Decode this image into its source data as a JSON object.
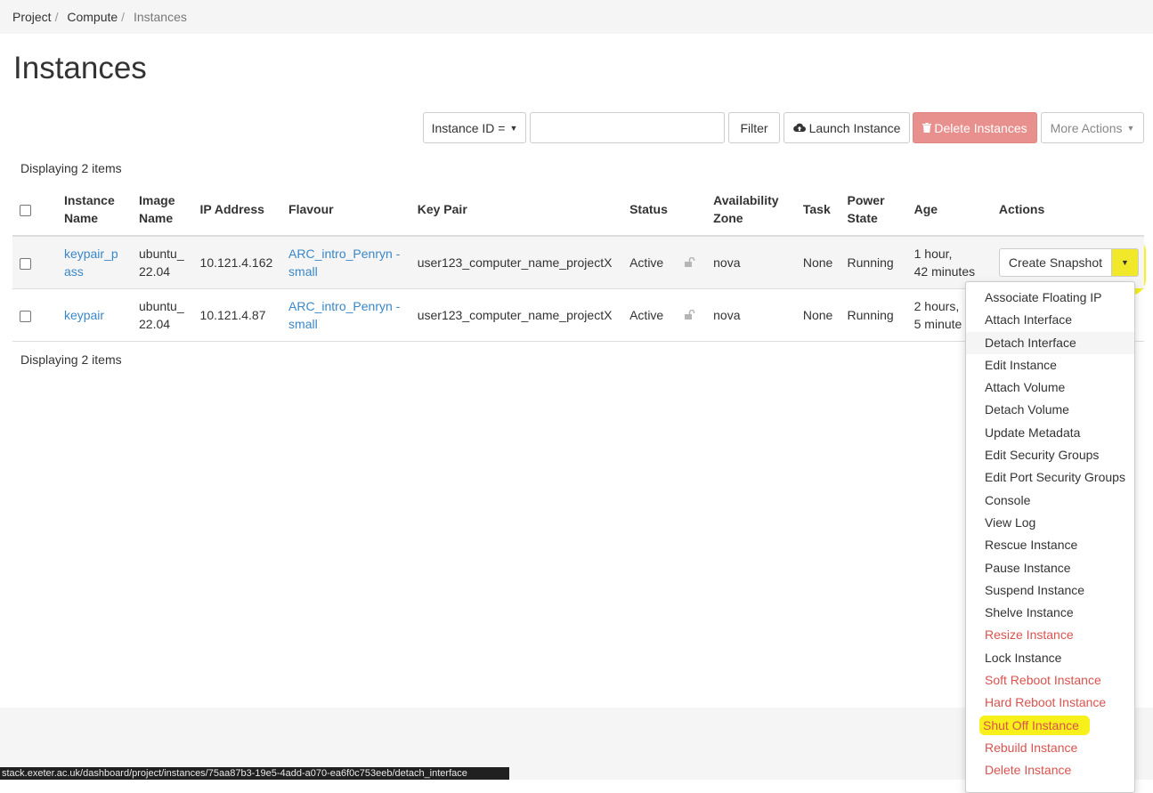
{
  "breadcrumb": [
    "Project",
    "Compute",
    "Instances"
  ],
  "page_title": "Instances",
  "toolbar": {
    "filter_field": "Instance ID =",
    "filter_value": "",
    "filter_label": "Filter",
    "launch_label": "Launch Instance",
    "delete_label": "Delete Instances",
    "more_label": "More Actions"
  },
  "count_text": "Displaying 2 items",
  "table": {
    "headers": {
      "name": [
        "Instance",
        "Name"
      ],
      "image": [
        "Image",
        "Name"
      ],
      "ip": "IP Address",
      "flavour": "Flavour",
      "keypair": "Key Pair",
      "status": "Status",
      "zone": [
        "Availability",
        "Zone"
      ],
      "task": "Task",
      "power": [
        "Power",
        "State"
      ],
      "age": "Age",
      "actions": "Actions"
    },
    "rows": [
      {
        "name": [
          "keypair_p",
          "ass"
        ],
        "image": [
          "ubuntu_",
          "22.04"
        ],
        "ip": "10.121.4.162",
        "flavour": [
          "ARC_intro_Penryn -",
          "small"
        ],
        "keypair": "user123_computer_name_projectX",
        "status": "Active",
        "zone": "nova",
        "task": "None",
        "power": "Running",
        "age": [
          "1 hour,",
          "42 minutes"
        ],
        "action": "Create Snapshot"
      },
      {
        "name": [
          "keypair",
          ""
        ],
        "image": [
          "ubuntu_",
          "22.04"
        ],
        "ip": "10.121.4.87",
        "flavour": [
          "ARC_intro_Penryn -",
          "small"
        ],
        "keypair": "user123_computer_name_projectX",
        "status": "Active",
        "zone": "nova",
        "task": "None",
        "power": "Running",
        "age": [
          "2 hours,",
          "5 minute"
        ],
        "action": ""
      }
    ]
  },
  "dropdown": [
    {
      "label": "Associate Floating IP",
      "danger": false
    },
    {
      "label": "Attach Interface",
      "danger": false
    },
    {
      "label": "Detach Interface",
      "danger": false,
      "hover": true
    },
    {
      "label": "Edit Instance",
      "danger": false
    },
    {
      "label": "Attach Volume",
      "danger": false
    },
    {
      "label": "Detach Volume",
      "danger": false
    },
    {
      "label": "Update Metadata",
      "danger": false
    },
    {
      "label": "Edit Security Groups",
      "danger": false
    },
    {
      "label": "Edit Port Security Groups",
      "danger": false
    },
    {
      "label": "Console",
      "danger": false
    },
    {
      "label": "View Log",
      "danger": false
    },
    {
      "label": "Rescue Instance",
      "danger": false
    },
    {
      "label": "Pause Instance",
      "danger": false
    },
    {
      "label": "Suspend Instance",
      "danger": false
    },
    {
      "label": "Shelve Instance",
      "danger": false
    },
    {
      "label": "Resize Instance",
      "danger": true
    },
    {
      "label": "Lock Instance",
      "danger": false
    },
    {
      "label": "Soft Reboot Instance",
      "danger": true
    },
    {
      "label": "Hard Reboot Instance",
      "danger": true
    },
    {
      "label": "Shut Off Instance",
      "danger": true,
      "highlight": true
    },
    {
      "label": "Rebuild Instance",
      "danger": true
    },
    {
      "label": "Delete Instance",
      "danger": true
    }
  ],
  "status_bar_url": "stack.exeter.ac.uk/dashboard/project/instances/75aa87b3-19e5-4add-a070-ea6f0c753eeb/detach_interface",
  "colors": {
    "link": "#3a87c7",
    "danger": "#d9534f",
    "highlight": "#f7f01a",
    "delete_button": "#e8908d"
  }
}
